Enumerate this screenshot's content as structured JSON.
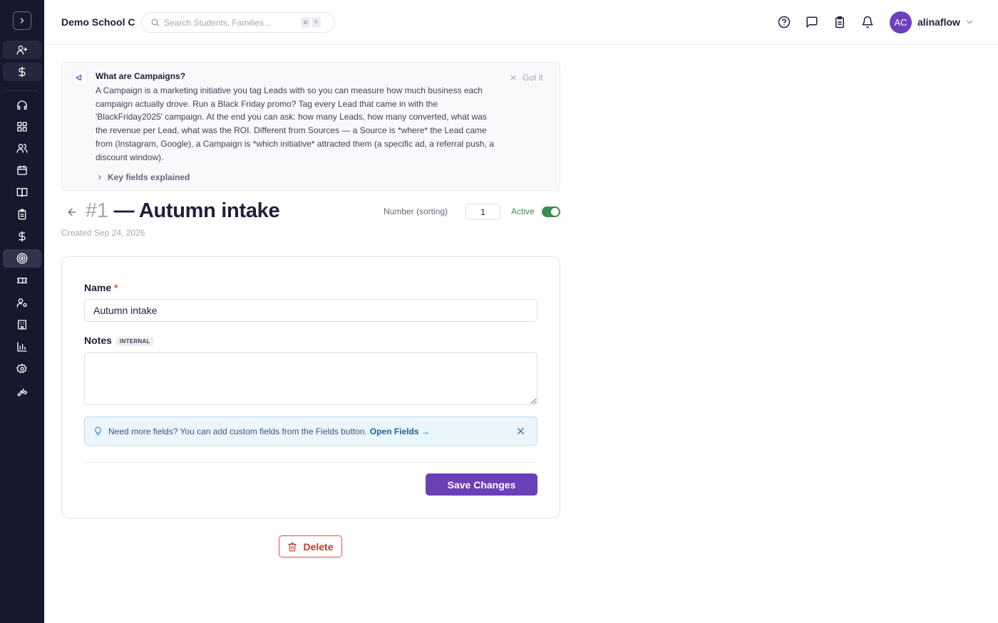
{
  "header": {
    "school_name": "Demo School C",
    "search_placeholder": "Search Students, Families...",
    "shortcut_keys": [
      "⌘",
      "K"
    ],
    "user_initials": "AC",
    "username": "alinaflow"
  },
  "sidebar": {
    "items": [
      {
        "icon": "user-plus-icon"
      },
      {
        "icon": "dollar-icon"
      },
      {
        "icon": "headset-icon"
      },
      {
        "icon": "dashboard-icon"
      },
      {
        "icon": "users-icon"
      },
      {
        "icon": "calendar-icon"
      },
      {
        "icon": "book-icon"
      },
      {
        "icon": "clipboard-icon"
      },
      {
        "icon": "dollar-icon"
      },
      {
        "icon": "target-icon",
        "active": true
      },
      {
        "icon": "ticket-icon"
      },
      {
        "icon": "user-gear-icon"
      },
      {
        "icon": "building-icon"
      },
      {
        "icon": "bar-chart-icon"
      },
      {
        "icon": "settings-icon"
      },
      {
        "icon": "wrench-icon"
      }
    ]
  },
  "info": {
    "title": "What are Campaigns?",
    "body": "A Campaign is a marketing initiative you tag Leads with so you can measure how much business each campaign actually drove. Run a Black Friday promo? Tag every Lead that came in with the 'BlackFriday2025' campaign. At the end you can ask: how many Leads, how many converted, what was the revenue per Lead, what was the ROI. Different from Sources — a Source is *where* the Lead came from (Instagram, Google), a Campaign is *which initiative* attracted them (a specific ad, a referral push, a discount window).",
    "dismiss_label": "Got it",
    "key_fields_label": "Key fields explained"
  },
  "record": {
    "number": "#1",
    "title": "— Autumn intake",
    "created": "Created Sep 24, 2026",
    "sort_label": "Number (sorting)",
    "sort_value": "1",
    "active_label": "Active",
    "active": true
  },
  "form": {
    "name_label": "Name",
    "required_mark": "*",
    "name_value": "Autumn intake",
    "notes_label": "Notes",
    "notes_badge": "INTERNAL",
    "notes_value": "",
    "tip_text": "Need more fields? You can add custom fields from the Fields button.",
    "tip_link": "Open Fields →",
    "save_label": "Save Changes"
  },
  "actions": {
    "delete_label": "Delete"
  },
  "colors": {
    "sidebar_bg": "#17172e",
    "primary": "#6a3fb8",
    "active_green": "#3b8c4f",
    "danger": "#c0392b"
  }
}
